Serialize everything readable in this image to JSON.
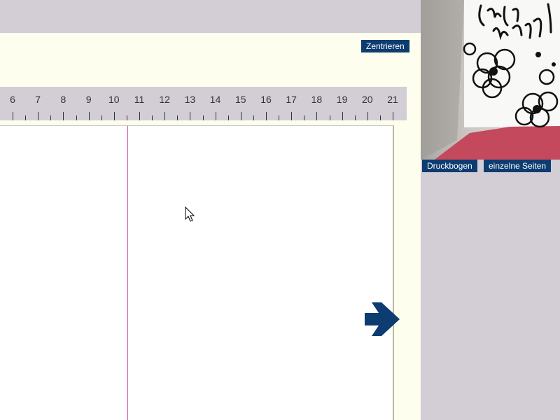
{
  "toolbar": {
    "center_label": "Zentrieren"
  },
  "ruler": {
    "labels": [
      "6",
      "7",
      "8",
      "9",
      "10",
      "11",
      "12",
      "13",
      "14",
      "15",
      "16",
      "17",
      "18",
      "19",
      "20",
      "21"
    ]
  },
  "preview": {
    "card_text_line1": "Glück",
    "card_text_line2": "wunsch!",
    "tab_sheet": "Druckbogen",
    "tab_pages": "einzelne Seiten"
  },
  "colors": {
    "accent": "#0d3c70",
    "guide": "#d24aa8",
    "workspace": "#fefeee",
    "panel": "#d3cdd6"
  },
  "icons": {
    "next": "arrow-right-icon",
    "pointer": "mouse-cursor-icon"
  }
}
